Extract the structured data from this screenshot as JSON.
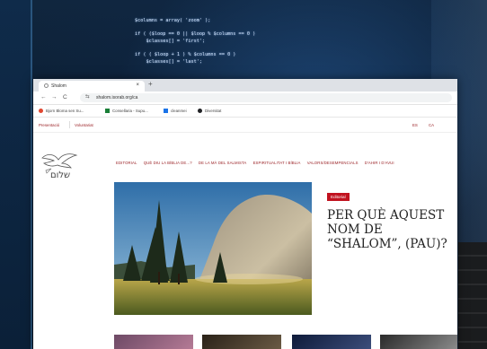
{
  "background": {
    "code_lines": [
      "$columns = array( 'zoom' );",
      "",
      "if ( ($loop == 0 || $loop % $columns == 0 )",
      "    $classes[] = 'first';",
      "",
      "if ( ( $loop + 1 ) % $columns == 0 )",
      "    $classes[] = 'last';"
    ]
  },
  "browser": {
    "tab_title": "Shalom",
    "new_tab": "+",
    "close": "×",
    "nav": {
      "back": "←",
      "forward": "→",
      "reload": "C"
    },
    "url": "shalom.isorab.org/ca",
    "bookmarks": [
      {
        "label": "Bjorn Bloma sen Su...",
        "color": "#e0462f",
        "shape": "dot"
      },
      {
        "label": "Consellaria - Supu...",
        "color": "#1a7f37",
        "shape": "sq"
      },
      {
        "label": "cleanmei",
        "color": "#1a73e8",
        "shape": "sq"
      },
      {
        "label": "Diversitat",
        "color": "#202124",
        "shape": "dot"
      }
    ]
  },
  "site": {
    "top_links": [
      "Presentació",
      "Voluntariat"
    ],
    "languages": [
      "ES",
      "CA"
    ],
    "logo_text": "שלום",
    "menu": [
      "EDITORIAL",
      "QUÈ DIU LA BÍBLIA DE...?",
      "DE LA MÀ DEL SALMISTA",
      "ESPIRITUALITAT I BÍBLIA",
      "VALORS/DESEMPENCIALS",
      "D'AHIR I D'AVUI"
    ],
    "featured": {
      "category": "Editorial",
      "title": "PER QUÈ AQUEST NOM DE “SHALOM”, (PAU)?"
    }
  },
  "colors": {
    "accent": "#9b2226",
    "badge": "#c1121f"
  }
}
